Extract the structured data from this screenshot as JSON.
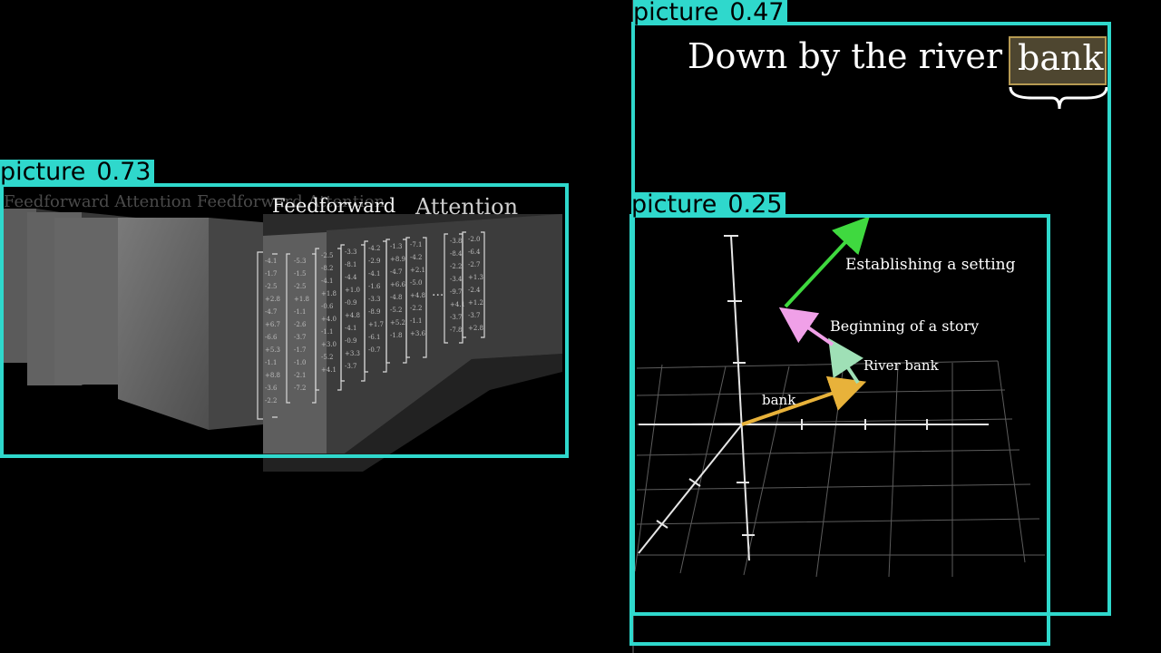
{
  "detections": [
    {
      "label": "picture",
      "score": "0.73"
    },
    {
      "label": "picture",
      "score": "0.47"
    },
    {
      "label": "picture",
      "score": "0.25"
    }
  ],
  "left_scene": {
    "labels": [
      "Feedforward",
      "Attention"
    ],
    "faded_labels": "Feedforward Attention Feedforward Attention",
    "ellipsis": "..."
  },
  "right_scene": {
    "sentence_prefix": "Down by the river",
    "highlight_word": "bank",
    "vectors": [
      {
        "label": "bank",
        "color": "#e8b23a"
      },
      {
        "label": "River bank",
        "color": "#9fe0b6"
      },
      {
        "label": "Beginning of a story",
        "color": "#f0a0e8"
      },
      {
        "label": "Establishing a setting",
        "color": "#3fd93f"
      }
    ]
  }
}
